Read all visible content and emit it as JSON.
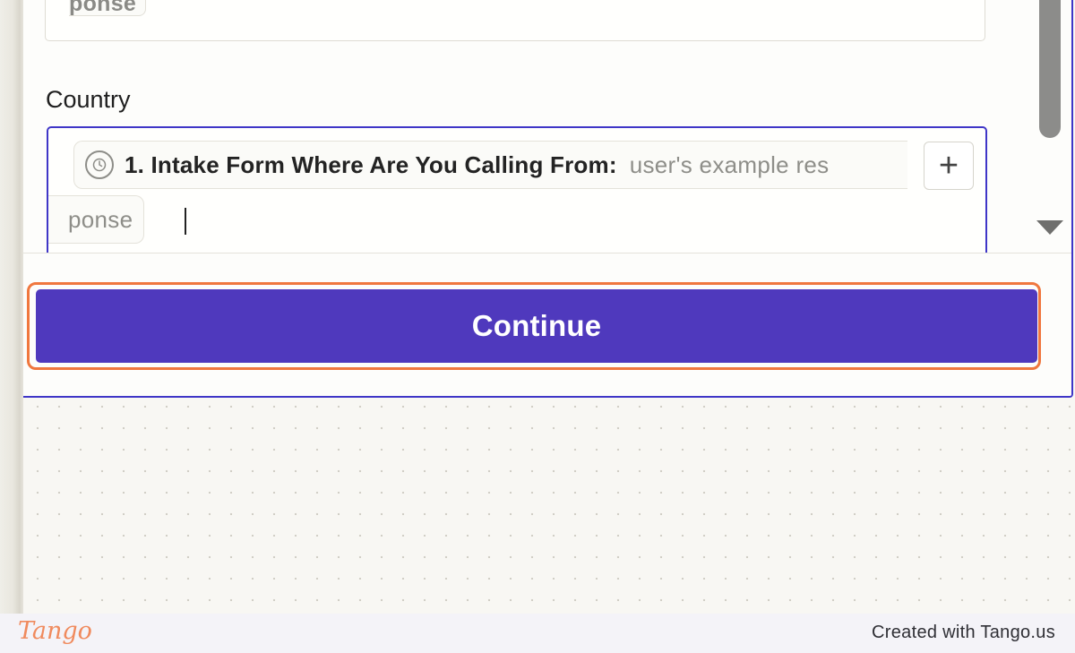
{
  "previous_field": {
    "chip_fragment": "ponse"
  },
  "country_field": {
    "label": "Country",
    "chip_key": "1. Intake Form Where Are You Calling From:",
    "chip_value": "user's example res",
    "chip_value_continued": "ponse",
    "add_button_symbol": "+",
    "chip_icon": "clock-icon"
  },
  "actions": {
    "continue_label": "Continue"
  },
  "footer": {
    "logo_text": "Tango",
    "created_text": "Created with Tango.us"
  },
  "colors": {
    "accent": "#4f39bd",
    "focus_border": "#3f36c7",
    "highlight": "#f0773e",
    "brand": "#f08a5d"
  }
}
